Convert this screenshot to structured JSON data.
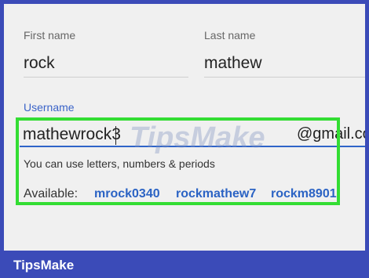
{
  "form": {
    "first_name": {
      "label": "First name",
      "value": "rock"
    },
    "last_name": {
      "label": "Last name",
      "value": "mathew"
    },
    "username": {
      "label": "Username",
      "value": "mathewrock3",
      "domain_suffix": "@gmail.com",
      "hint": "You can use letters, numbers & periods",
      "available_label": "Available:",
      "suggestions": [
        "mrock0340",
        "rockmathew7",
        "rockm8901"
      ]
    }
  },
  "colors": {
    "highlight_border": "#33dd33",
    "accent": "#2f64c9",
    "frame_background": "#3b4bb8"
  },
  "watermark": "TipsMake",
  "footer": {
    "brand": "TipsMake"
  }
}
